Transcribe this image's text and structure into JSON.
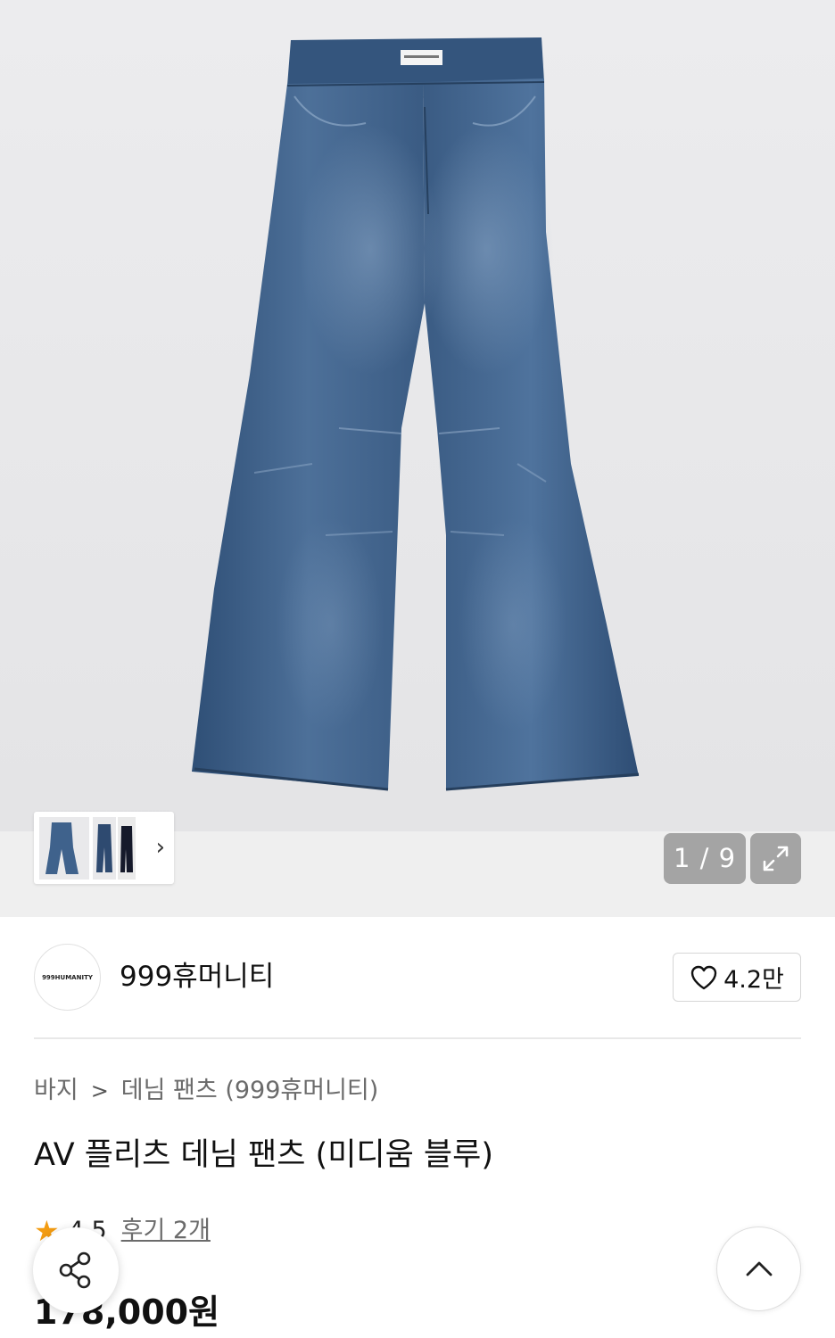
{
  "gallery": {
    "counter_current": "1",
    "counter_separator": "/",
    "counter_total": "9",
    "image_alt": "denim-wide-pants"
  },
  "brand": {
    "logo_text": "999HUMANITY",
    "name": "999휴머니티",
    "like_count": "4.2만"
  },
  "breadcrumb": {
    "level1": "바지",
    "separator": ">",
    "level2": "데님 팬츠 (999휴머니티)"
  },
  "product": {
    "title": "AV 플리츠 데님 팬츠 (미디움 블루)",
    "rating": "4.5",
    "review_label": "후기 2개",
    "price": "178,000원"
  },
  "colors": {
    "star": "#f39c12",
    "denim": "#3b5f88"
  }
}
